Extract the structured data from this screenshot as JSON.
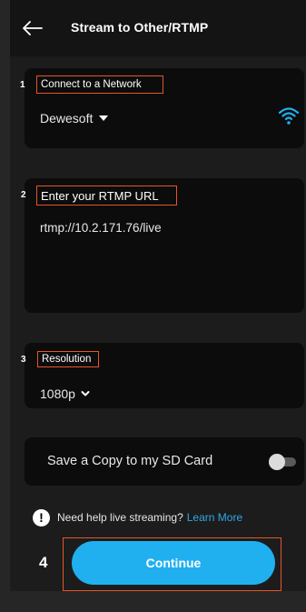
{
  "header": {
    "title": "Stream to Other/RTMP",
    "back_icon": "arrow-left-icon"
  },
  "network": {
    "step": "1",
    "label": "Connect to a Network",
    "selected": "Dewesoft",
    "icon": "wifi-icon",
    "icon_color": "#1fb0f0"
  },
  "rtmp": {
    "step": "2",
    "label": "Enter your RTMP URL",
    "value": "rtmp://10.2.171.76/live"
  },
  "resolution": {
    "step": "3",
    "label": "Resolution",
    "selected": "1080p"
  },
  "sd_card": {
    "label": "Save a Copy to my SD Card",
    "enabled": false
  },
  "help": {
    "text": "Need help live streaming?",
    "link": "Learn More",
    "link_color": "#2fa8e8"
  },
  "continue": {
    "step": "4",
    "label": "Continue",
    "color": "#20b0f0"
  },
  "annotation_color": "#e8542b"
}
